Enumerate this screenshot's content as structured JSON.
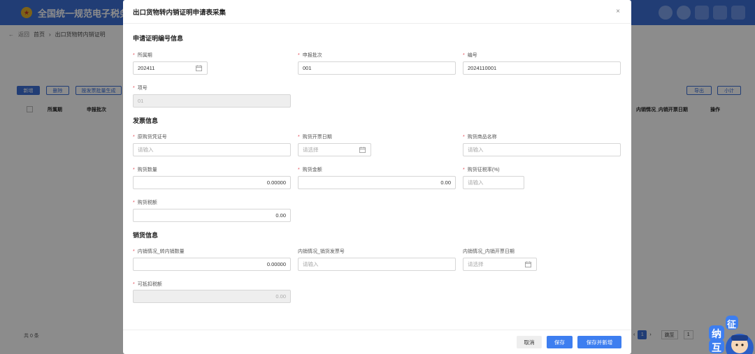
{
  "background": {
    "system_title": "全国统一规范电子税务",
    "breadcrumb": {
      "back": "返回",
      "home": "首页",
      "current": "出口货物转内销证明"
    },
    "toolbar": {
      "add": "新增",
      "delete": "删除",
      "batch": "按发票批量生成",
      "export": "导出",
      "summary": "小计"
    },
    "table_headers": [
      "所属期",
      "申报批次",
      "内销情况_内销开票日期",
      "操作"
    ],
    "total_text": "共 0 条",
    "pager": {
      "page": "1",
      "goto_label": "跳至",
      "goto_value": "1"
    }
  },
  "modal": {
    "title": "出口货物转内销证明申请表采集",
    "close": "×",
    "sections": {
      "cert": "申请证明编号信息",
      "invoice": "发票信息",
      "sales": "销货信息"
    },
    "fields": {
      "period": {
        "label": "所属期",
        "value": "202411"
      },
      "batch": {
        "label": "申报批次",
        "value": "001"
      },
      "number": {
        "label": "编号",
        "value": "2024110001"
      },
      "item_no": {
        "label": "项号",
        "value": "01"
      },
      "orig_voucher": {
        "label": "原购货凭证号",
        "placeholder": "请输入"
      },
      "purchase_invoice_date": {
        "label": "购货开票日期",
        "placeholder": "请选择"
      },
      "purchase_goods_name": {
        "label": "购货商品名称",
        "placeholder": "请输入"
      },
      "purchase_qty": {
        "label": "购货数量",
        "value": "0.00000"
      },
      "purchase_amount": {
        "label": "购货金额",
        "value": "0.00"
      },
      "purchase_tax_rate": {
        "label": "购货征税率(%)",
        "placeholder": "请输入"
      },
      "purchase_tax": {
        "label": "购货税额",
        "value": "0.00"
      },
      "domestic_qty": {
        "label": "内销情况_转内销数量",
        "value": "0.00000"
      },
      "domestic_invoice_no": {
        "label": "内销情况_销货发票号",
        "placeholder": "请输入"
      },
      "domestic_invoice_date": {
        "label": "内销情况_内销开票日期",
        "placeholder": "请选择"
      },
      "deductible_tax": {
        "label": "可抵扣税额",
        "value": "0.00"
      }
    },
    "buttons": {
      "cancel": "取消",
      "save": "保存",
      "save_new": "保存并新增"
    }
  },
  "mascot_text": [
    "纳",
    "征",
    "互"
  ],
  "colors": {
    "brand": "#3d6fd6",
    "primary_button": "#3d7ef0",
    "required": "#e34d59"
  }
}
